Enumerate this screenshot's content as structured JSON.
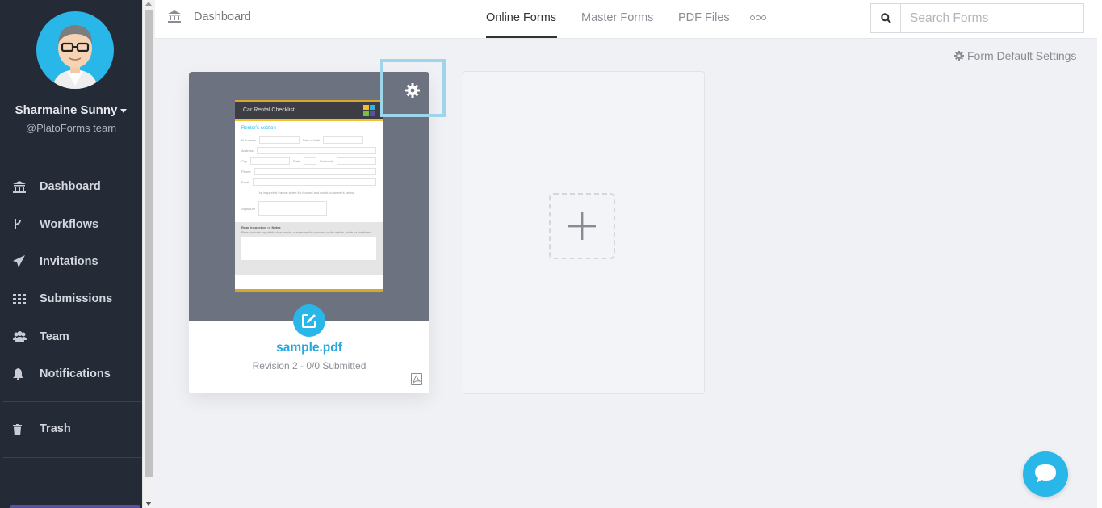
{
  "user": {
    "name": "Sharmaine Sunny",
    "team": "@PlatoForms team"
  },
  "sidebar": {
    "items": [
      {
        "label": "Dashboard",
        "icon": "bank-icon"
      },
      {
        "label": "Workflows",
        "icon": "branch-icon"
      },
      {
        "label": "Invitations",
        "icon": "paper-plane-icon"
      },
      {
        "label": "Submissions",
        "icon": "grid-icon"
      },
      {
        "label": "Team",
        "icon": "users-icon"
      },
      {
        "label": "Notifications",
        "icon": "bell-icon"
      }
    ],
    "trash": {
      "label": "Trash",
      "icon": "trash-icon"
    }
  },
  "header": {
    "breadcrumb": "Dashboard",
    "tabs": [
      {
        "label": "Online Forms",
        "active": true
      },
      {
        "label": "Master Forms",
        "active": false
      },
      {
        "label": "PDF Files",
        "active": false
      }
    ],
    "search": {
      "placeholder": "Search Forms"
    }
  },
  "main": {
    "settings_link": "Form Default Settings",
    "forms": [
      {
        "name": "sample.pdf",
        "meta": "Revision 2 - 0/0 Submitted",
        "preview": {
          "title": "Car Rental Checklist",
          "section": "Renter's section",
          "fields": [
            "Full name",
            "Date of birth",
            "Address",
            "City",
            "State",
            "Postcode",
            "Phone",
            "Email",
            "Signature"
          ],
          "checkbox_text": "I've inspected the car when it's booked and noted customer's below",
          "footer_title": "Road inspection ••• Notes",
          "footer_text": "Please indicate any visible chips, marks, or scratches the customer on the outside, inside, or dashboard."
        }
      }
    ]
  },
  "colors": {
    "accent": "#29b6e8",
    "sidebar_bg": "#252a37",
    "page_bg": "#f0f1f5"
  }
}
